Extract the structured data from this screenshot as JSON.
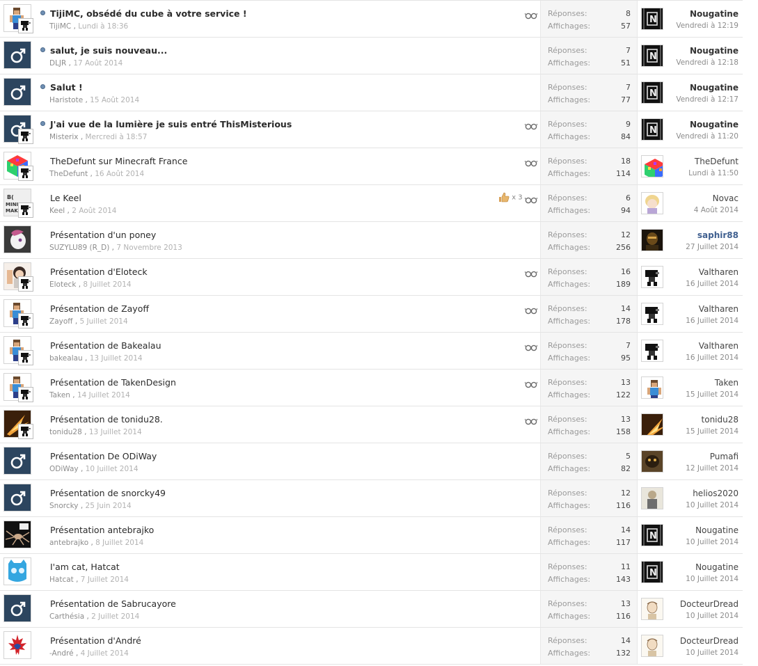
{
  "labels": {
    "replies": "Réponses:",
    "views": "Affichages:"
  },
  "colors": {
    "male_avatar_bg": "#2c455f",
    "staff_name": "#3f5f8f",
    "unread_dot": "#6f8fb3"
  },
  "threads": [
    {
      "title": "TijiMC, obsédé du cube à votre service !",
      "author": "TijiMC",
      "date": "Lundi à 18:36",
      "replies": "8",
      "views": "57",
      "last_user": "Nougatine",
      "last_date": "Vendredi à 12:19",
      "unread": true,
      "avatar": "minecraft-skin",
      "mini": true,
      "watched": true,
      "likes": null,
      "last_avatar": "nougatine-n",
      "last_style": "bold"
    },
    {
      "title": "salut, je suis nouveau...",
      "author": "DLJR",
      "date": "17 Août 2014",
      "replies": "7",
      "views": "51",
      "last_user": "Nougatine",
      "last_date": "Vendredi à 12:18",
      "unread": true,
      "avatar": "male",
      "mini": false,
      "watched": false,
      "likes": null,
      "last_avatar": "nougatine-n",
      "last_style": "bold"
    },
    {
      "title": "Salut !",
      "author": "Haristote",
      "date": "15 Août 2014",
      "replies": "7",
      "views": "77",
      "last_user": "Nougatine",
      "last_date": "Vendredi à 12:17",
      "unread": true,
      "avatar": "male",
      "mini": false,
      "watched": false,
      "likes": null,
      "last_avatar": "nougatine-n",
      "last_style": "bold"
    },
    {
      "title": "J'ai vue de la lumière je suis entré ThisMisterious",
      "author": "Misterix",
      "date": "Mercredi à 18:57",
      "replies": "9",
      "views": "84",
      "last_user": "Nougatine",
      "last_date": "Vendredi à 11:20",
      "unread": true,
      "avatar": "male",
      "mini": true,
      "watched": true,
      "likes": null,
      "last_avatar": "nougatine-n",
      "last_style": "bold"
    },
    {
      "title": "TheDefunt sur Minecraft France",
      "author": "TheDefunt",
      "date": "16 Août 2014",
      "replies": "18",
      "views": "114",
      "last_user": "TheDefunt",
      "last_date": "Lundi à 11:50",
      "unread": false,
      "avatar": "rainbow-cube",
      "mini": true,
      "watched": true,
      "likes": null,
      "last_avatar": "rainbow-cube",
      "last_style": "normal"
    },
    {
      "title": "Le Keel",
      "author": "Keel",
      "date": "2 Août 2014",
      "replies": "6",
      "views": "94",
      "last_user": "Novac",
      "last_date": "4 Août 2014",
      "unread": false,
      "avatar": "mini-maker",
      "mini": true,
      "watched": true,
      "likes": "x 3",
      "last_avatar": "anime-blonde",
      "last_style": "normal"
    },
    {
      "title": "Présentation d'un poney",
      "author": "SUZYLU89 (R_D)",
      "date": "7 Novembre 2013",
      "replies": "12",
      "views": "256",
      "last_user": "saphir88",
      "last_date": "27 Juillet 2014",
      "unread": false,
      "avatar": "pony",
      "mini": false,
      "watched": false,
      "likes": null,
      "last_avatar": "dark-warrior",
      "last_style": "staff"
    },
    {
      "title": "Présentation d'Eloteck",
      "author": "Eloteck",
      "date": "8 Juillet 2014",
      "replies": "16",
      "views": "189",
      "last_user": "Valtharen",
      "last_date": "16 Juillet 2014",
      "unread": false,
      "avatar": "girl",
      "mini": true,
      "watched": true,
      "likes": null,
      "last_avatar": "blocky-black",
      "last_style": "normal"
    },
    {
      "title": "Présentation de Zayoff",
      "author": "Zayoff",
      "date": "5 Juillet 2014",
      "replies": "14",
      "views": "178",
      "last_user": "Valtharen",
      "last_date": "16 Juillet 2014",
      "unread": false,
      "avatar": "minecraft-skin",
      "mini": true,
      "watched": true,
      "likes": null,
      "last_avatar": "blocky-black",
      "last_style": "normal"
    },
    {
      "title": "Présentation de Bakealau",
      "author": "bakealau",
      "date": "13 Juillet 2014",
      "replies": "7",
      "views": "95",
      "last_user": "Valtharen",
      "last_date": "16 Juillet 2014",
      "unread": false,
      "avatar": "minecraft-skin",
      "mini": true,
      "watched": true,
      "likes": null,
      "last_avatar": "blocky-black",
      "last_style": "normal"
    },
    {
      "title": "Présentation de TakenDesign",
      "author": "Taken",
      "date": "14 Juillet 2014",
      "replies": "13",
      "views": "122",
      "last_user": "Taken",
      "last_date": "15 Juillet 2014",
      "unread": false,
      "avatar": "minecraft-skin",
      "mini": true,
      "watched": true,
      "likes": null,
      "last_avatar": "minecraft-skin",
      "last_style": "normal"
    },
    {
      "title": "Présentation de tonidu28.",
      "author": "tonidu28",
      "date": "13 Juillet 2014",
      "replies": "13",
      "views": "158",
      "last_user": "tonidu28",
      "last_date": "15 Juillet 2014",
      "unread": false,
      "avatar": "fire",
      "mini": true,
      "watched": true,
      "likes": null,
      "last_avatar": "fire",
      "last_style": "normal"
    },
    {
      "title": "Présentation De ODiWay",
      "author": "ODiWay",
      "date": "10 Juillet 2014",
      "replies": "5",
      "views": "82",
      "last_user": "Pumafi",
      "last_date": "12 Juillet 2014",
      "unread": false,
      "avatar": "male",
      "mini": false,
      "watched": false,
      "likes": null,
      "last_avatar": "brown-creature",
      "last_style": "normal"
    },
    {
      "title": "Présentation de snorcky49",
      "author": "Snorcky",
      "date": "25 Juin 2014",
      "replies": "12",
      "views": "116",
      "last_user": "helios2020",
      "last_date": "10 Juillet 2014",
      "unread": false,
      "avatar": "male",
      "mini": false,
      "watched": false,
      "likes": null,
      "last_avatar": "grey-figure",
      "last_style": "normal"
    },
    {
      "title": "Présentation antebrajko",
      "author": "antebrajko",
      "date": "8 Juillet 2014",
      "replies": "14",
      "views": "117",
      "last_user": "Nougatine",
      "last_date": "10 Juillet 2014",
      "unread": false,
      "avatar": "spider",
      "mini": false,
      "watched": false,
      "likes": null,
      "last_avatar": "nougatine-n",
      "last_style": "normal"
    },
    {
      "title": "I'am cat, Hatcat",
      "author": "Hatcat",
      "date": "7 Juillet 2014",
      "replies": "11",
      "views": "143",
      "last_user": "Nougatine",
      "last_date": "10 Juillet 2014",
      "unread": false,
      "avatar": "blue-cat",
      "mini": false,
      "watched": false,
      "likes": null,
      "last_avatar": "nougatine-n",
      "last_style": "normal"
    },
    {
      "title": "Présentation de Sabrucayore",
      "author": "Carthésia",
      "date": "2 Juillet 2014",
      "replies": "13",
      "views": "116",
      "last_user": "DocteurDread",
      "last_date": "10 Juillet 2014",
      "unread": false,
      "avatar": "male",
      "mini": false,
      "watched": false,
      "likes": null,
      "last_avatar": "sketch-face",
      "last_style": "normal"
    },
    {
      "title": "Présentation d'André",
      "author": "-André",
      "date": "4 Juillet 2014",
      "replies": "14",
      "views": "132",
      "last_user": "DocteurDread",
      "last_date": "10 Juillet 2014",
      "unread": false,
      "avatar": "quebec-flag",
      "mini": false,
      "watched": false,
      "likes": null,
      "last_avatar": "sketch-face",
      "last_style": "normal"
    }
  ]
}
